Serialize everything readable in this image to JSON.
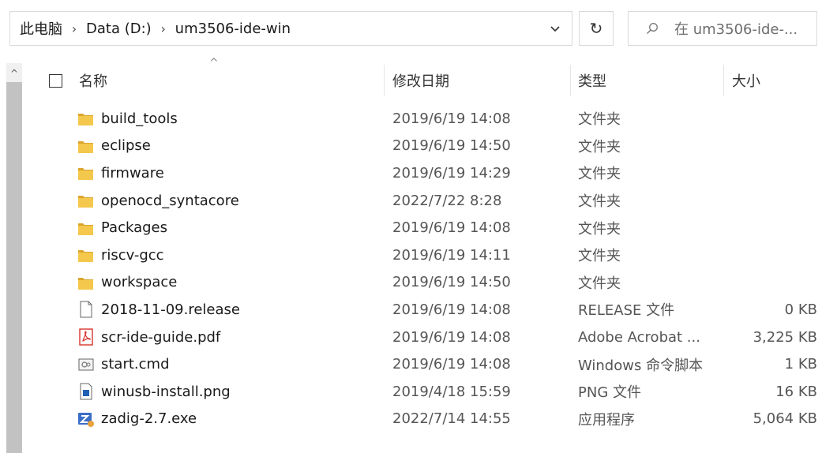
{
  "breadcrumb": {
    "items": [
      "此电脑",
      "Data (D:)",
      "um3506-ide-win"
    ]
  },
  "search": {
    "placeholder": "在 um3506-ide-..."
  },
  "columns": {
    "name": "名称",
    "date": "修改日期",
    "type": "类型",
    "size": "大小"
  },
  "files": [
    {
      "name": "build_tools",
      "date": "2019/6/19 14:08",
      "type": "文件夹",
      "size": "",
      "icon": "folder-icon"
    },
    {
      "name": "eclipse",
      "date": "2019/6/19 14:50",
      "type": "文件夹",
      "size": "",
      "icon": "folder-icon"
    },
    {
      "name": "firmware",
      "date": "2019/6/19 14:29",
      "type": "文件夹",
      "size": "",
      "icon": "folder-icon"
    },
    {
      "name": "openocd_syntacore",
      "date": "2022/7/22 8:28",
      "type": "文件夹",
      "size": "",
      "icon": "folder-icon"
    },
    {
      "name": "Packages",
      "date": "2019/6/19 14:08",
      "type": "文件夹",
      "size": "",
      "icon": "folder-icon"
    },
    {
      "name": "riscv-gcc",
      "date": "2019/6/19 14:11",
      "type": "文件夹",
      "size": "",
      "icon": "folder-icon"
    },
    {
      "name": "workspace",
      "date": "2019/6/19 14:50",
      "type": "文件夹",
      "size": "",
      "icon": "folder-icon"
    },
    {
      "name": "2018-11-09.release",
      "date": "2019/6/19 14:08",
      "type": "RELEASE 文件",
      "size": "0 KB",
      "icon": "blank-file-icon"
    },
    {
      "name": "scr-ide-guide.pdf",
      "date": "2019/6/19 14:08",
      "type": "Adobe Acrobat ...",
      "size": "3,225 KB",
      "icon": "pdf-file-icon"
    },
    {
      "name": "start.cmd",
      "date": "2019/6/19 14:08",
      "type": "Windows 命令脚本",
      "size": "1 KB",
      "icon": "cmd-file-icon"
    },
    {
      "name": "winusb-install.png",
      "date": "2019/4/18 15:59",
      "type": "PNG 文件",
      "size": "16 KB",
      "icon": "image-file-icon"
    },
    {
      "name": "zadig-2.7.exe",
      "date": "2022/7/14 14:55",
      "type": "应用程序",
      "size": "5,064 KB",
      "icon": "exe-file-icon"
    }
  ],
  "colors": {
    "folder": "#f4c84c",
    "folder_dark": "#dba52c",
    "pdf_red": "#d9332b",
    "exe_blue": "#3a6ec7",
    "border": "#d9d9d9"
  }
}
